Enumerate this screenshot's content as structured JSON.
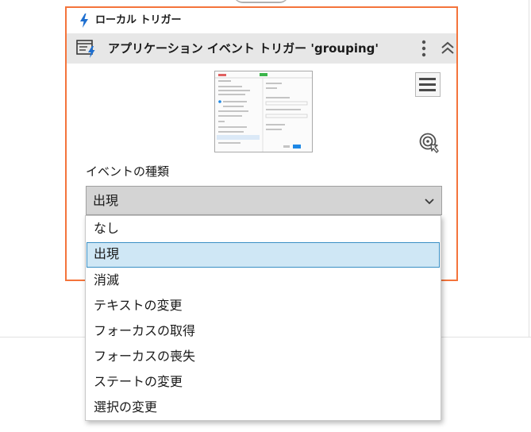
{
  "header": {
    "label": "ローカル トリガー"
  },
  "trigger": {
    "title": "アプリケーション イベント トリガー 'grouping'"
  },
  "event_type": {
    "label": "イベントの種類",
    "selected": "出現"
  },
  "dropdown": {
    "options": [
      "なし",
      "出現",
      "消滅",
      "テキストの変更",
      "フォーカスの取得",
      "フォーカスの喪失",
      "ステートの変更",
      "選択の変更"
    ],
    "selected_index": 1
  },
  "colors": {
    "card_border": "#f4743b",
    "bolt": "#1e6fd0",
    "selected_bg": "#cfe7f5",
    "selected_border": "#3a8fc4",
    "select_bg": "#d4d4d4"
  }
}
